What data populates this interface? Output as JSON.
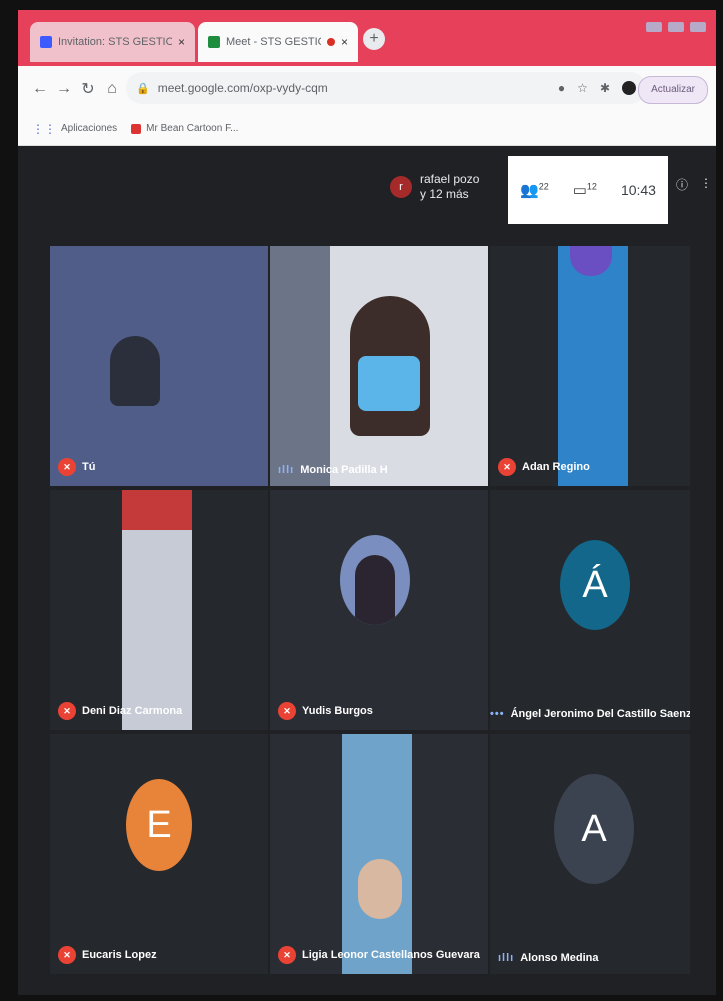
{
  "browser": {
    "tabs": [
      {
        "title": "Invitation: STS GESTION DE AMI",
        "active": false
      },
      {
        "title": "Meet - STS GESTION DE AMI",
        "active": true
      }
    ],
    "new_tab_icon": "plus-icon",
    "url": "meet.google.com/oxp-vydy-cqm",
    "update_label": "Actualizar",
    "bookmarks": [
      {
        "label": "Aplicaciones",
        "icon": "apps-grid-icon"
      },
      {
        "label": "Mr Bean Cartoon F...",
        "icon": "video-bookmark-icon"
      }
    ]
  },
  "meet": {
    "presenter": {
      "initial": "r",
      "line1": "rafael pozo",
      "line2": "y 12 más"
    },
    "top_panel": {
      "people_count": "22",
      "chat_count": "12",
      "time": "10:43"
    },
    "participants": [
      {
        "name": "Tú",
        "muted": true,
        "type": "video",
        "bg": "#4f5d88"
      },
      {
        "name": "Monica Padilla H",
        "muted": false,
        "type": "video",
        "bg": "#3a3f4a"
      },
      {
        "name": "Adan Regino",
        "muted": true,
        "type": "video",
        "bg": "#2c3444"
      },
      {
        "name": "Deni Diaz Carmona",
        "muted": true,
        "type": "video",
        "bg": "#262a30"
      },
      {
        "name": "Yudis Burgos",
        "muted": true,
        "type": "avatar-photo",
        "bg": "#2a2d33"
      },
      {
        "name": "Ángel Jeronimo Del Castillo Saenz",
        "muted": false,
        "type": "avatar",
        "initial": "Á",
        "avatar_color": "#12678a",
        "bg": "#25282c"
      },
      {
        "name": "Eucaris Lopez",
        "muted": true,
        "type": "avatar",
        "initial": "E",
        "avatar_color": "#e8833a",
        "bg": "#25282c"
      },
      {
        "name": "Ligia Leonor Castellanos Guevara",
        "muted": true,
        "type": "video",
        "bg": "#2a2d33"
      },
      {
        "name": "Alonso Medina",
        "muted": false,
        "type": "avatar",
        "initial": "A",
        "avatar_color": "#3c4350",
        "bg": "#25282c"
      }
    ]
  }
}
